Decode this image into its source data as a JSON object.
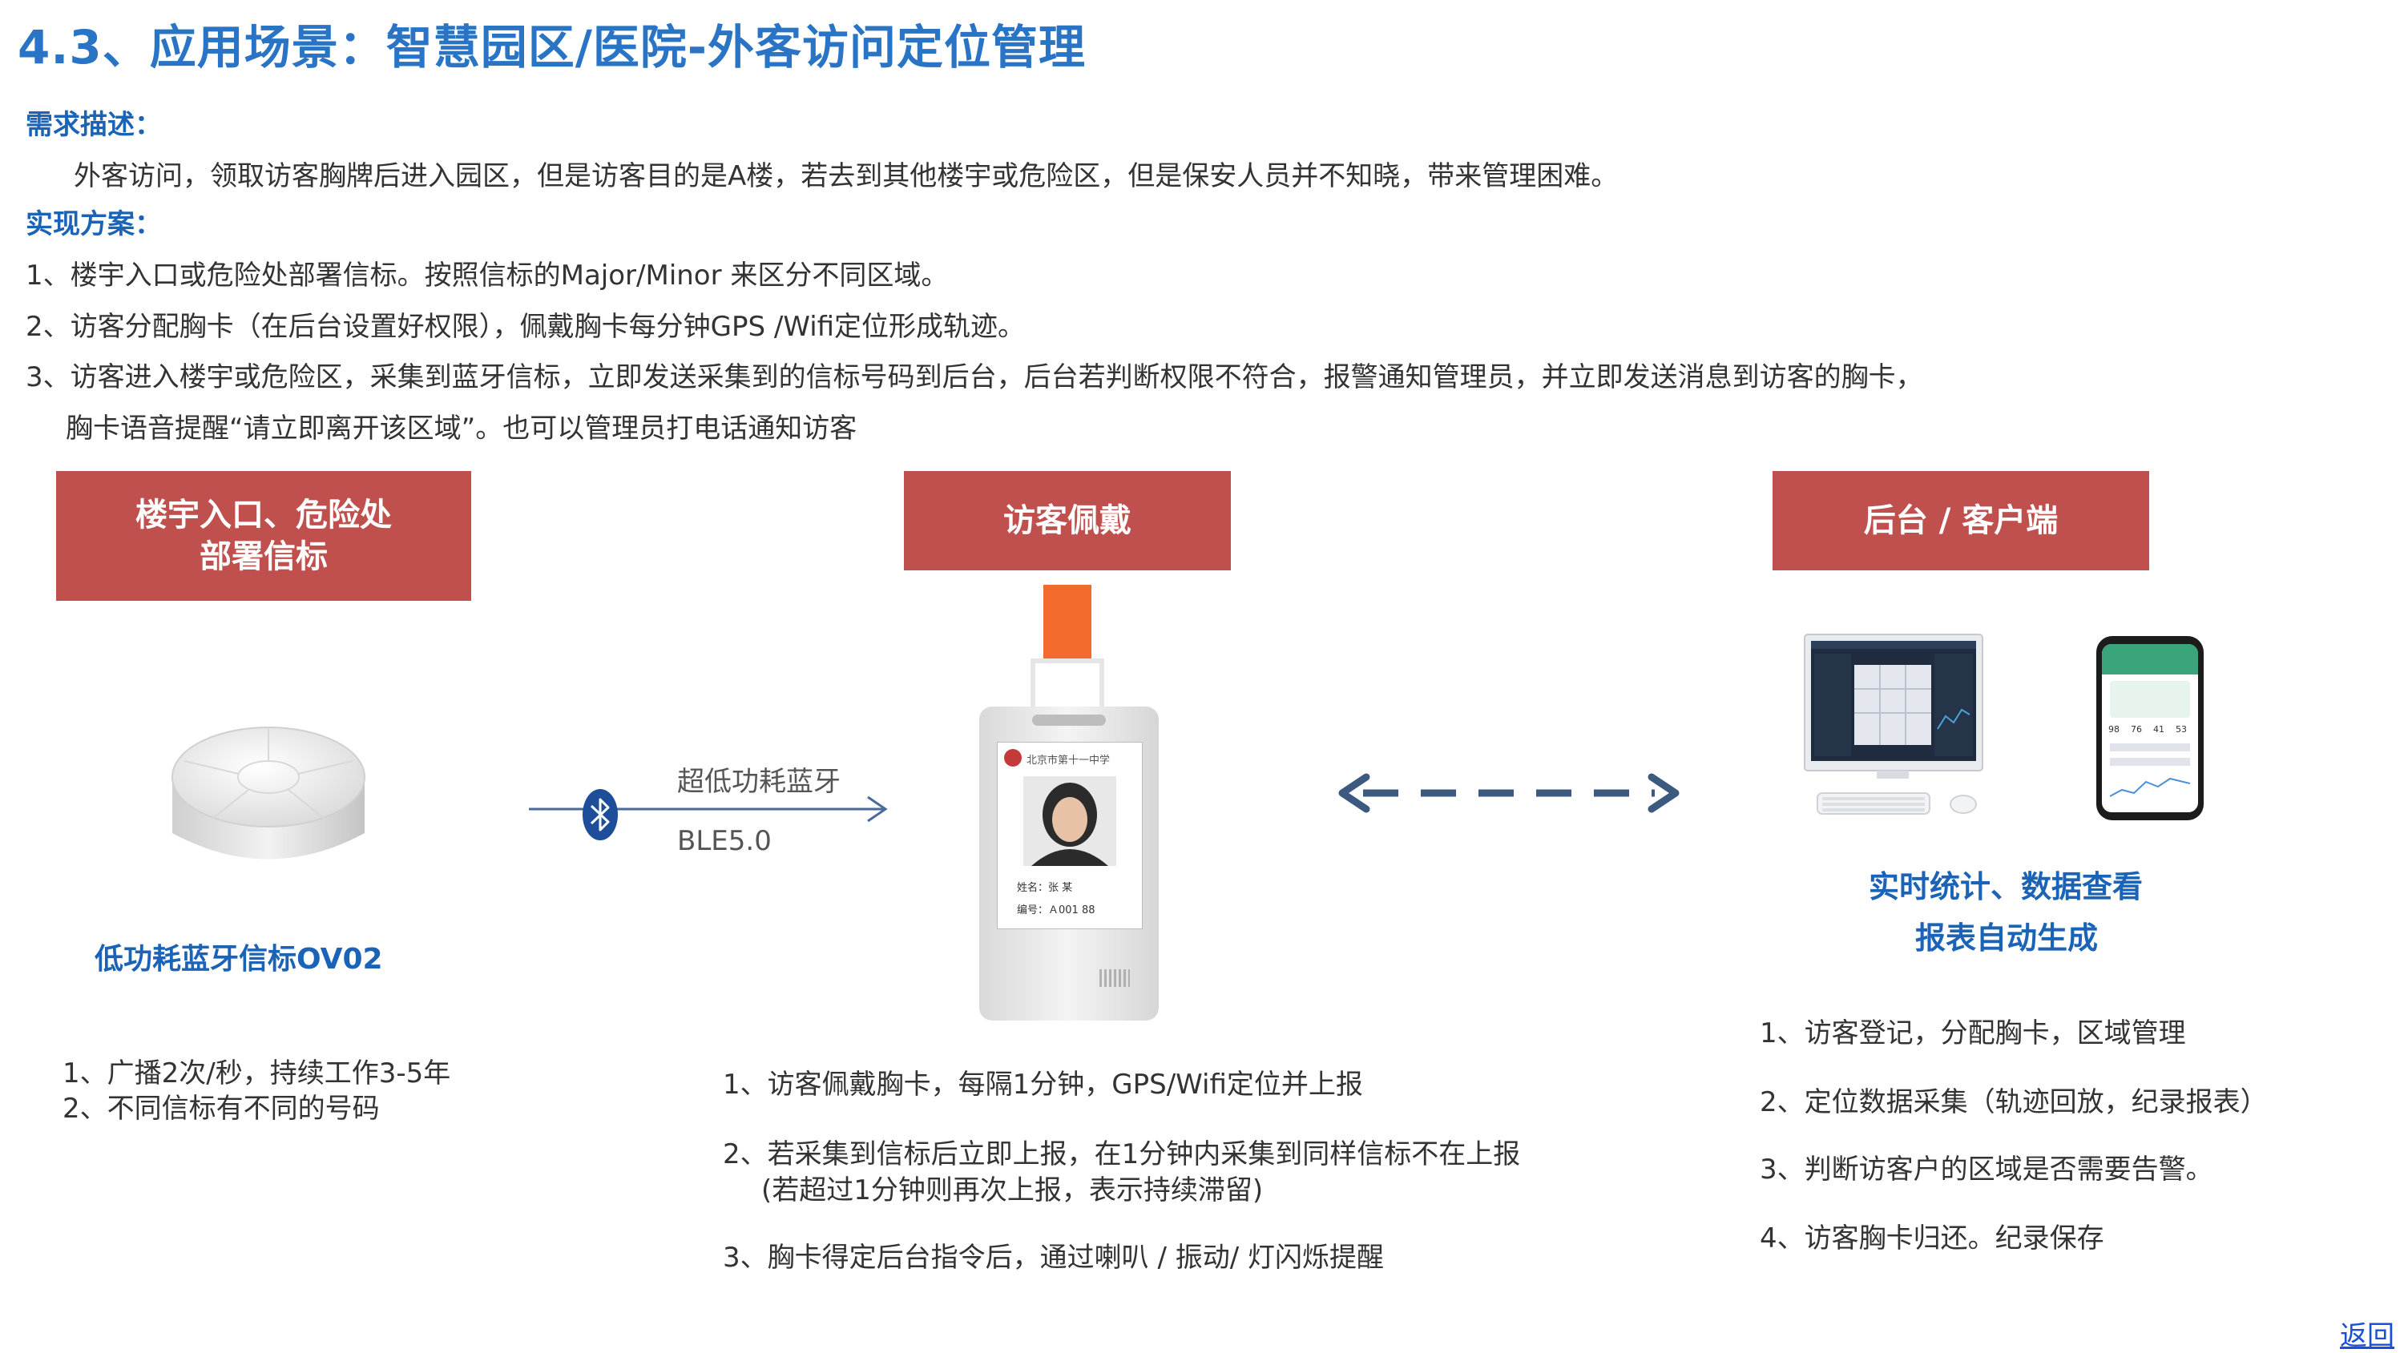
{
  "page_title": "4.3、应用场景：智慧园区/医院-外客访问定位管理",
  "requirement": {
    "heading": "需求描述：",
    "text": "外客访问，领取访客胸牌后进入园区，但是访客目的是A楼，若去到其他楼宇或危险区，但是保安人员并不知晓，带来管理困难。"
  },
  "solution": {
    "heading": "实现方案：",
    "lines": [
      "1、楼宇入口或危险处部署信标。按照信标的Major/Minor 来区分不同区域。",
      "2、访客分配胸卡（在后台设置好权限），佩戴胸卡每分钟GPS /Wifi定位形成轨迹。",
      "3、访客进入楼宇或危险区，采集到蓝牙信标，立即发送采集到的信标号码到后台，后台若判断权限不符合，报警通知管理员，并立即发送消息到访客的胸卡，",
      "胸卡语音提醒“请立即离开该区域”。也可以管理员打电话通知访客"
    ]
  },
  "col_beacon": {
    "header_line1": "楼宇入口、危险处",
    "header_line2": "部署信标",
    "caption": "低功耗蓝牙信标OV02",
    "items": [
      "1、广播2次/秒，持续工作3-5年",
      "2、不同信标有不同的号码"
    ]
  },
  "link": {
    "label_top": "超低功耗蓝牙",
    "label_bottom": "BLE5.0"
  },
  "col_visitor": {
    "header": "访客佩戴",
    "badge": {
      "org": "北京市第十一中学",
      "name_line": "姓名：张  某",
      "id_line": "编号：Ａ001  88"
    },
    "items": [
      "1、访客佩戴胸卡，每隔1分钟，GPS/Wifi定位并上报",
      "2、若采集到信标后立即上报，在1分钟内采集到同样信标不在上报",
      "(若超过1分钟则再次上报，表示持续滞留)",
      "3、胸卡得定后台指令后，通过喇叭 / 振动/ 灯闪烁提醒"
    ]
  },
  "col_backend": {
    "header": "后台 / 客户端",
    "caption_line1": "实时统计、数据查看",
    "caption_line2": "报表自动生成",
    "phone_stats": [
      "98",
      "76",
      "41",
      "53"
    ],
    "items": [
      "1、访客登记，分配胸卡，区域管理",
      "2、定位数据采集（轨迹回放，纪录报表）",
      "3、判断访客户的区域是否需要告警。",
      "4、访客胸卡归还。纪录保存"
    ]
  },
  "footer": {
    "return_label": "返回"
  },
  "colors": {
    "title": "#2a74c5",
    "heading_blue": "#1b63b6",
    "header_red": "#c0504d",
    "arrow": "#3c5a80",
    "lanyard": "#f26a2e",
    "bluetooth": "#1e4e9a"
  },
  "icons": [
    "bluetooth-icon",
    "beacon-device",
    "badge-device",
    "monitor-device",
    "phone-device",
    "double-arrow-icon"
  ]
}
